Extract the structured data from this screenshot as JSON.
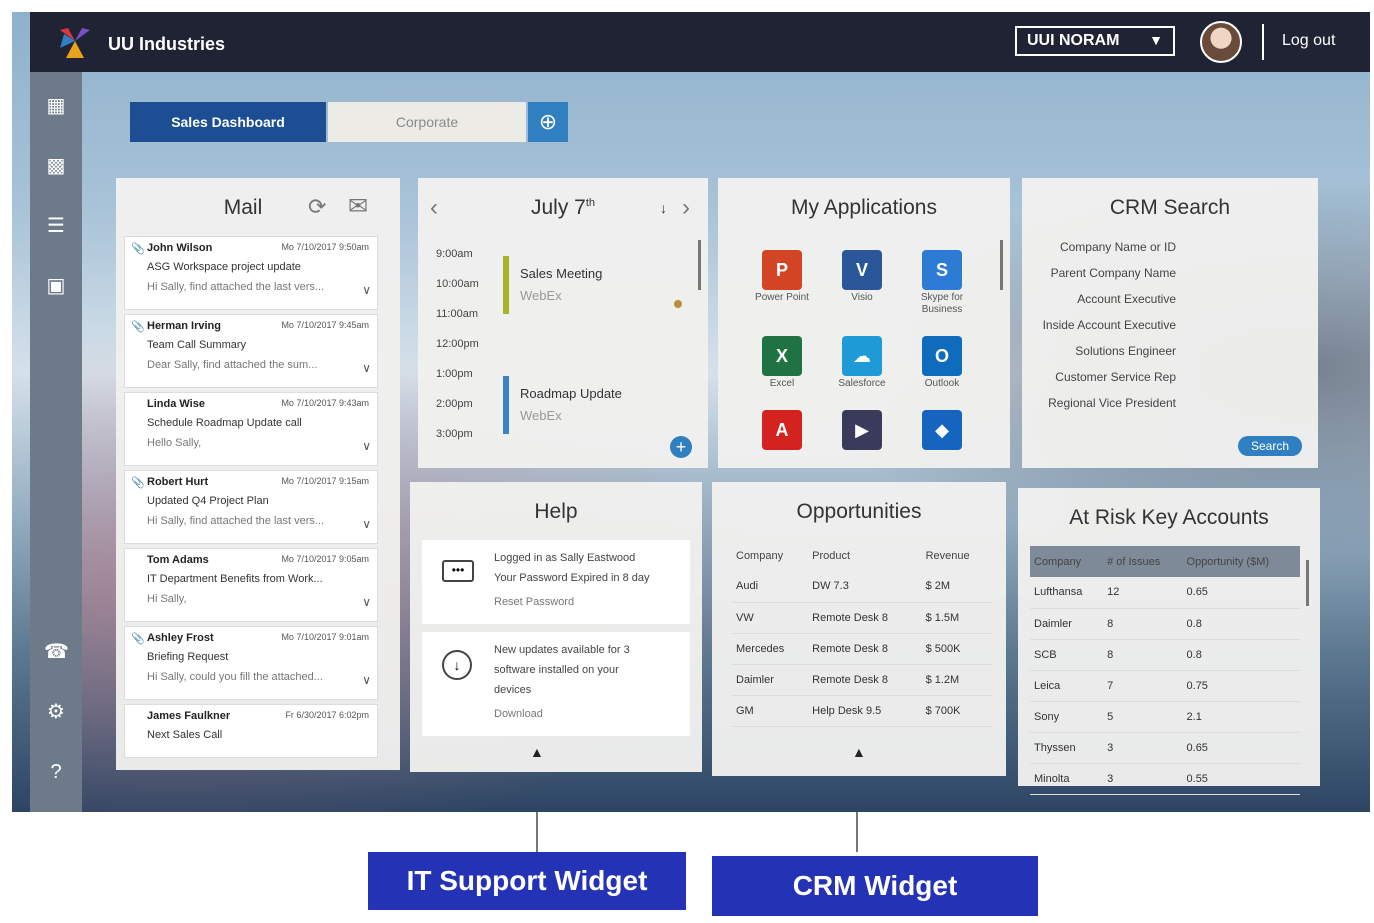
{
  "app": {
    "brand": "UU Industries",
    "region": "UUI NORAM",
    "logout": "Log out"
  },
  "tabs": {
    "active": "Sales Dashboard",
    "inactive": "Corporate"
  },
  "mail": {
    "title": "Mail",
    "items": [
      {
        "from": "John Wilson",
        "date": "Mo 7/10/2017 9:50am",
        "subject": "ASG Workspace project update",
        "preview": "Hi Sally, find attached the last vers..."
      },
      {
        "from": "Herman Irving",
        "date": "Mo 7/10/2017 9:45am",
        "subject": "Team Call Summary",
        "preview": "Dear Sally, find attached the sum..."
      },
      {
        "from": "Linda Wise",
        "date": "Mo 7/10/2017 9:43am",
        "subject": "Schedule Roadmap Update call",
        "preview": "Hello Sally,"
      },
      {
        "from": "Robert Hurt",
        "date": "Mo 7/10/2017 9:15am",
        "subject": "Updated Q4 Project Plan",
        "preview": "Hi Sally, find attached the last vers..."
      },
      {
        "from": "Tom Adams",
        "date": "Mo 7/10/2017 9:05am",
        "subject": "IT Department Benefits from Work...",
        "preview": "Hi Sally,"
      },
      {
        "from": "Ashley Frost",
        "date": "Mo 7/10/2017 9:01am",
        "subject": "Briefing Request",
        "preview": "Hi Sally, could you fill the attached..."
      },
      {
        "from": "James Faulkner",
        "date": "Fr 6/30/2017 6:02pm",
        "subject": "Next Sales Call",
        "preview": ""
      }
    ]
  },
  "calendar": {
    "title": "July 7",
    "title_sup": "th",
    "times": [
      "9:00am",
      "10:00am",
      "11:00am",
      "12:00pm",
      "1:00pm",
      "2:00pm",
      "3:00pm"
    ],
    "events": [
      {
        "title": "Sales Meeting",
        "sub": "WebEx",
        "color": "#a8b42c"
      },
      {
        "title": "Roadmap Update",
        "sub": "WebEx",
        "color": "#3b83c4"
      }
    ]
  },
  "apps": {
    "title": "My Applications",
    "items": [
      {
        "label": "Power Point",
        "icon": "powerpoint-icon",
        "glyph": "P",
        "color": "#d24625"
      },
      {
        "label": "Visio",
        "icon": "visio-icon",
        "glyph": "V",
        "color": "#2b579a"
      },
      {
        "label": "Skype for Business",
        "icon": "skype-icon",
        "glyph": "S",
        "color": "#2d7bd4"
      },
      {
        "label": "Excel",
        "icon": "excel-icon",
        "glyph": "X",
        "color": "#1f7244"
      },
      {
        "label": "Salesforce",
        "icon": "salesforce-icon",
        "glyph": "☁",
        "color": "#1e9ad6"
      },
      {
        "label": "Outlook",
        "icon": "outlook-icon",
        "glyph": "O",
        "color": "#0f6cbd"
      },
      {
        "label": "",
        "icon": "pdf-icon",
        "glyph": "A",
        "color": "#d3231f"
      },
      {
        "label": "",
        "icon": "media-player-icon",
        "glyph": "▶",
        "color": "#3a3a5c"
      },
      {
        "label": "",
        "icon": "dropbox-icon",
        "glyph": "◆",
        "color": "#1565c0"
      }
    ]
  },
  "crm": {
    "title": "CRM Search",
    "fields": [
      "Company Name or ID",
      "Parent Company Name",
      "Account Executive",
      "Inside Account Executive",
      "Solutions Engineer",
      "Customer Service Rep",
      "Regional Vice President"
    ],
    "search": "Search"
  },
  "help": {
    "title": "Help",
    "login_lines": [
      "Logged in as Sally Eastwood",
      "Your Password Expired in 8 day"
    ],
    "reset": "Reset Password",
    "update_lines": [
      "New updates available for 3",
      "software installed on your",
      "devices"
    ],
    "download": "Download"
  },
  "opps": {
    "title": "Opportunities",
    "headers": [
      "Company",
      "Product",
      "Revenue"
    ],
    "rows": [
      [
        "Audi",
        "DW 7.3",
        "$ 2M"
      ],
      [
        "VW",
        "Remote Desk 8",
        "$ 1.5M"
      ],
      [
        "Mercedes",
        "Remote Desk 8",
        "$ 500K"
      ],
      [
        "Daimler",
        "Remote Desk 8",
        "$ 1.2M"
      ],
      [
        "GM",
        "Help Desk 9.5",
        "$ 700K"
      ]
    ]
  },
  "risk": {
    "title": "At Risk Key Accounts",
    "headers": [
      "Company",
      "# of Issues",
      "Opportunity ($M)"
    ],
    "rows": [
      [
        "Lufthansa",
        "12",
        "0.65"
      ],
      [
        "Daimler",
        "8",
        "0.8"
      ],
      [
        "SCB",
        "8",
        "0.8"
      ],
      [
        "Leica",
        "7",
        "0.75"
      ],
      [
        "Sony",
        "5",
        "2.1"
      ],
      [
        "Thyssen",
        "3",
        "0.65"
      ],
      [
        "Minolta",
        "3",
        "0.55"
      ]
    ]
  },
  "callouts": {
    "it": "IT Support Widget",
    "crm": "CRM Widget"
  }
}
